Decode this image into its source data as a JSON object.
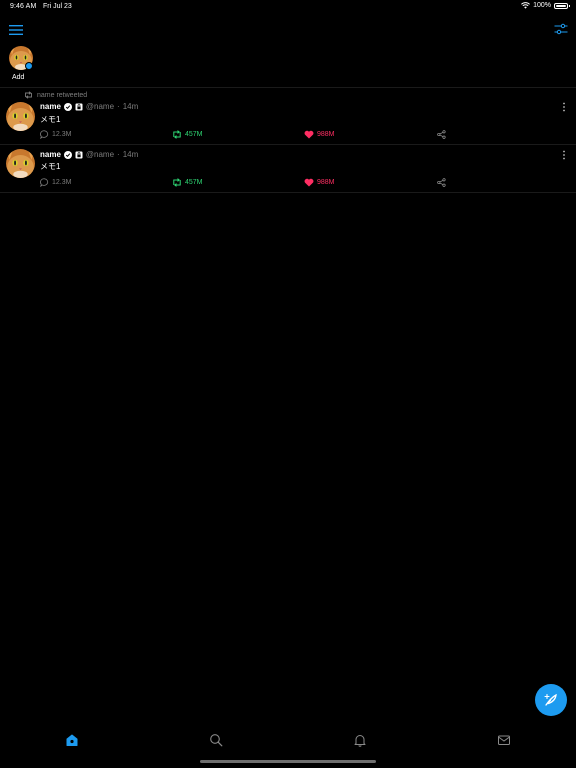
{
  "status_bar": {
    "time": "9:46 AM",
    "date": "Fri Jul 23",
    "battery_text": "100%",
    "battery_level": 1.0
  },
  "header": {
    "menu_icon": "hamburger-menu-icon",
    "filter_icon": "sliders-icon"
  },
  "accounts": {
    "add_label": "Add"
  },
  "tweets": [
    {
      "retweeted_by": "name retweeted",
      "name": "name",
      "handle": "@name",
      "separator": "·",
      "time": "14m",
      "text": "メモ1",
      "replies": "12.3M",
      "retweets": "457M",
      "likes": "988M"
    },
    {
      "retweeted_by": "",
      "name": "name",
      "handle": "@name",
      "separator": "·",
      "time": "14m",
      "text": "メモ1",
      "replies": "12.3M",
      "retweets": "457M",
      "likes": "988M"
    }
  ],
  "colors": {
    "accent": "#1d9bf0",
    "retweet": "#2ed573",
    "like": "#ff2e63",
    "muted": "#7c7c7c",
    "background": "#000000"
  },
  "tab_bar": {
    "tabs": [
      "home-icon",
      "search-icon",
      "bell-icon",
      "mail-icon"
    ],
    "active": "home-icon"
  },
  "fab_icon": "compose-feather-icon"
}
